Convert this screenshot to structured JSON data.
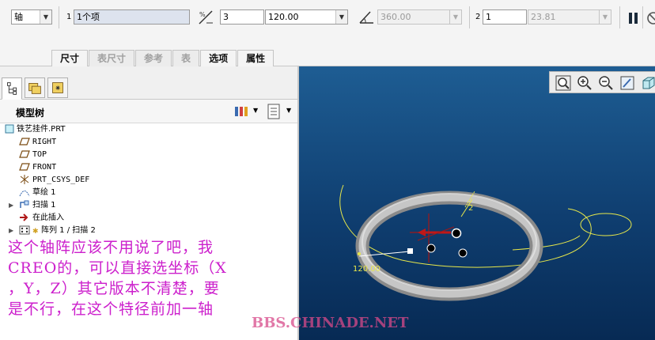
{
  "dashboard": {
    "type_select": "轴",
    "ref_count": "1",
    "ref_value": "1个项",
    "num_value": "3",
    "spacing_value": "120.00",
    "angle_value": "360.00",
    "dir2_count": "2",
    "dir2_num": "1",
    "dir2_spacing": "23.81"
  },
  "tabs": [
    "尺寸",
    "表尺寸",
    "参考",
    "表",
    "选项",
    "属性"
  ],
  "tabs_active": [
    "尺寸",
    "选项",
    "属性"
  ],
  "model_tree": {
    "title": "模型树",
    "items": [
      {
        "label": "铁艺挂件.PRT",
        "icon": "part-icon"
      },
      {
        "label": "RIGHT",
        "icon": "datum-plane-icon"
      },
      {
        "label": "TOP",
        "icon": "datum-plane-icon"
      },
      {
        "label": "FRONT",
        "icon": "datum-plane-icon"
      },
      {
        "label": "PRT_CSYS_DEF",
        "icon": "csys-icon"
      },
      {
        "label": "草绘 1",
        "icon": "sketch-icon"
      },
      {
        "label": "扫描 1",
        "icon": "sweep-icon"
      },
      {
        "label": "在此插入",
        "icon": "insert-arrow-icon"
      },
      {
        "label": "阵列 1 / 扫描 2",
        "icon": "pattern-icon"
      }
    ]
  },
  "viewport": {
    "dim_label": "120.00",
    "axis_label": "2"
  },
  "note_lines": [
    "这个轴阵应该不用说了吧，我",
    "CREO的，可以直接选坐标（X",
    "，Y，Z）其它版本不清楚，要",
    "是不行，在这个特径前加一轴"
  ],
  "watermark": "BBS.CHINADE.NET",
  "colors": {
    "viewport_top": "#1e5d93",
    "viewport_bottom": "#072a54",
    "annotation": "#cc1fcc",
    "curve": "#e8e84a"
  }
}
